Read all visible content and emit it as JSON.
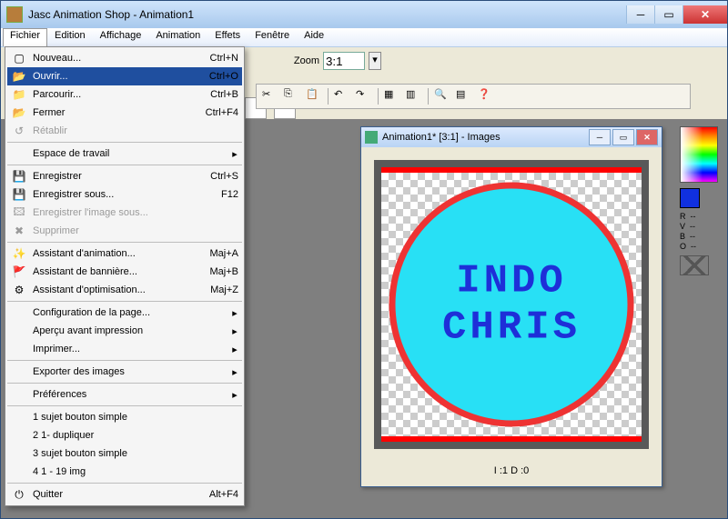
{
  "app": {
    "title": "Jasc Animation Shop - Animation1"
  },
  "menubar": {
    "file": "Fichier",
    "edit": "Edition",
    "view": "Affichage",
    "anim": "Animation",
    "fx": "Effets",
    "window": "Fenêtre",
    "help": "Aide"
  },
  "zoom": {
    "label": "Zoom",
    "value": "3:1"
  },
  "file_menu": {
    "new": {
      "label": "Nouveau...",
      "shortcut": "Ctrl+N"
    },
    "open": {
      "label": "Ouvrir...",
      "shortcut": "Ctrl+O"
    },
    "browse": {
      "label": "Parcourir...",
      "shortcut": "Ctrl+B"
    },
    "close": {
      "label": "Fermer",
      "shortcut": "Ctrl+F4"
    },
    "revert": {
      "label": "Rétablir",
      "shortcut": ""
    },
    "workspace": {
      "label": "Espace de travail",
      "shortcut": ""
    },
    "save": {
      "label": "Enregistrer",
      "shortcut": "Ctrl+S"
    },
    "saveas": {
      "label": "Enregistrer sous...",
      "shortcut": "F12"
    },
    "saveimg": {
      "label": "Enregistrer l'image sous...",
      "shortcut": ""
    },
    "delete": {
      "label": "Supprimer",
      "shortcut": ""
    },
    "wiz_anim": {
      "label": "Assistant d'animation...",
      "shortcut": "Maj+A"
    },
    "wiz_banner": {
      "label": "Assistant de bannière...",
      "shortcut": "Maj+B"
    },
    "wiz_opt": {
      "label": "Assistant d'optimisation...",
      "shortcut": "Maj+Z"
    },
    "page_setup": {
      "label": "Configuration de la page...",
      "shortcut": ""
    },
    "print_preview": {
      "label": "Aperçu avant impression",
      "shortcut": ""
    },
    "print": {
      "label": "Imprimer...",
      "shortcut": ""
    },
    "export": {
      "label": "Exporter des images",
      "shortcut": ""
    },
    "prefs": {
      "label": "Préférences",
      "shortcut": ""
    },
    "recent1": {
      "label": "1 sujet bouton simple"
    },
    "recent2": {
      "label": "2 1- dupliquer"
    },
    "recent3": {
      "label": "3 sujet bouton simple"
    },
    "recent4": {
      "label": "4 1 - 19 img"
    },
    "quit": {
      "label": "Quitter",
      "shortcut": "Alt+F4"
    }
  },
  "doc": {
    "title": "Animation1* [3:1] - Images",
    "text1": "INDO",
    "text2": "CHRIS",
    "status": "I :1   D :0"
  },
  "palette": {
    "swatch_color": "#1030e0",
    "letters": "R  --\nV  --\nB  --\nO  --"
  }
}
